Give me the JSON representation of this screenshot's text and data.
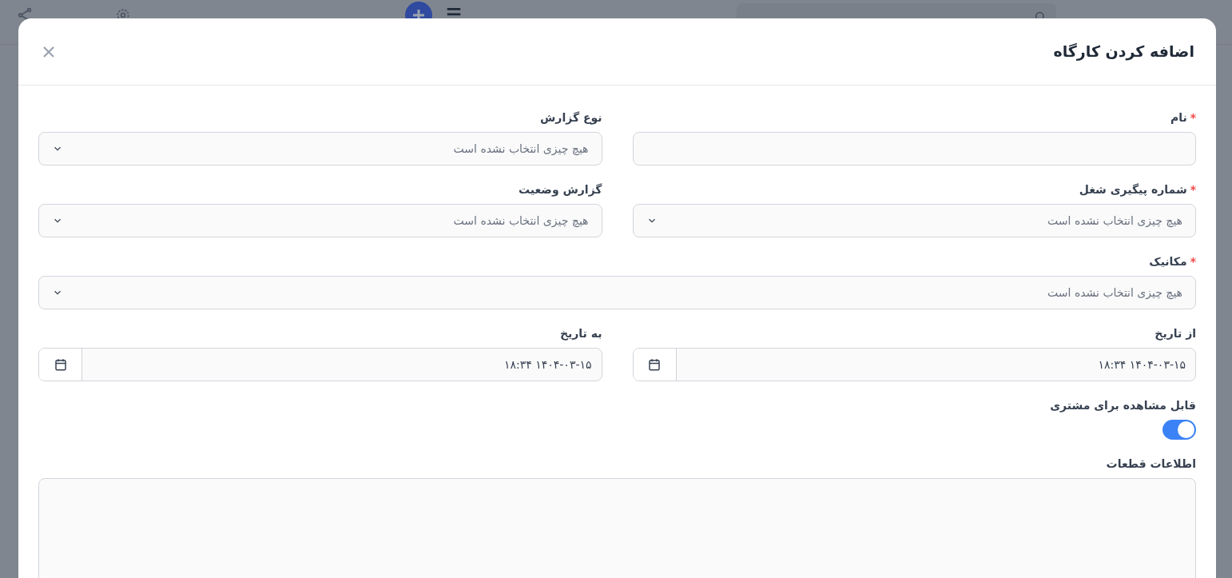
{
  "dialog": {
    "title": "اضافه کردن کارگاه",
    "rows": [
      [
        {
          "kind": "text",
          "label": "نام",
          "required_mark": "*"
        },
        {
          "kind": "select",
          "label": "نوع گزارش",
          "placeholder": "هیچ چیزی انتخاب نشده است"
        }
      ],
      [
        {
          "kind": "select",
          "label": "شماره پیگیری شغل",
          "required_mark": "*",
          "placeholder": "هیچ چیزی انتخاب نشده است"
        },
        {
          "kind": "select",
          "label": "گزارش وضعیت",
          "placeholder": "هیچ چیزی انتخاب نشده است"
        }
      ],
      [
        {
          "kind": "select",
          "label": "مکانیک",
          "required_mark": "*",
          "placeholder": "هیچ چیزی انتخاب نشده است"
        }
      ],
      [
        {
          "kind": "date",
          "label": "از تاریخ",
          "value": "۱۴۰۴-۰۳-۱۵ ۱۸:۳۴"
        },
        {
          "kind": "date",
          "label": "به تاریخ",
          "value": "۱۴۰۴-۰۳-۱۵ ۱۸:۳۴"
        }
      ],
      [
        {
          "kind": "toggle",
          "label": "قابل مشاهده برای مشتری",
          "on": true
        }
      ],
      [
        {
          "kind": "textarea",
          "label": "اطلاعات قطعات"
        }
      ]
    ]
  }
}
